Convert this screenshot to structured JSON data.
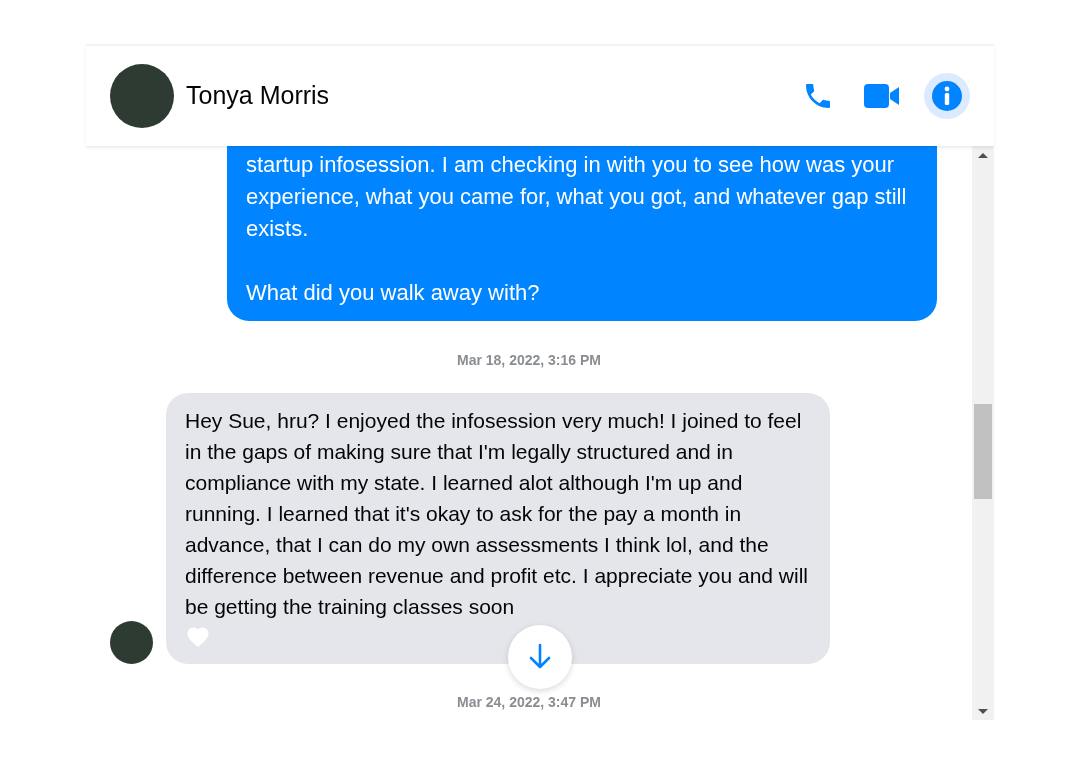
{
  "contact": {
    "name": "Tonya Morris"
  },
  "thread": [
    {
      "kind": "sent",
      "text": "startup infosession. I am checking in with you to see how was your experience, what you came for, what you got, and whatever gap still exists.\n\nWhat did you walk away with?"
    },
    {
      "kind": "timestamp",
      "text": "Mar 18, 2022, 3:16 PM"
    },
    {
      "kind": "received",
      "text": "Hey Sue, hru? I enjoyed the infosession very much! I joined to feel in the gaps of making sure that I'm legally structured and in compliance with my state. I learned alot although I'm up and running.  I learned that it's okay to ask for the pay a month in advance, that I can do my own assessments I think lol, and the difference between revenue and profit etc.  I appreciate you and will be getting the training classes soon"
    },
    {
      "kind": "timestamp",
      "text": "Mar 24, 2022, 3:47 PM"
    }
  ]
}
